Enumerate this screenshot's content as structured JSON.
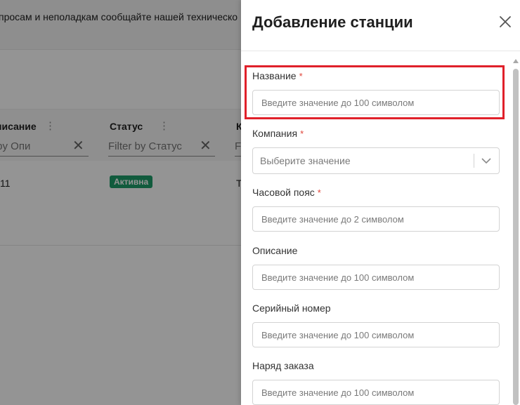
{
  "background": {
    "notice_text": "просам и неполадкам сообщайте нашей техническо",
    "columns": [
      {
        "title": "писание",
        "filter_placeholder": "r by Опи"
      },
      {
        "title": "Статус",
        "filter_placeholder": "Filter by Статус"
      },
      {
        "title": "К",
        "filter_placeholder": "F"
      }
    ],
    "row": {
      "description": "11",
      "status": "Активна",
      "next_col": "Т"
    },
    "colors": {
      "status_badge": "#1e9e6a"
    }
  },
  "drawer": {
    "title": "Добавление станции",
    "close_icon": "close-icon",
    "required_mark": "*",
    "fields": {
      "name": {
        "label": "Название",
        "placeholder": "Введите значение до 100 символом",
        "required": true
      },
      "company": {
        "label": "Компания",
        "placeholder": "Выберите значение",
        "required": true
      },
      "timezone": {
        "label": "Часовой пояс",
        "placeholder": "Введите значение до 2 символом",
        "required": true
      },
      "description": {
        "label": "Описание",
        "placeholder": "Введите значение до 100 символом",
        "required": false
      },
      "serial": {
        "label": "Серийный номер",
        "placeholder": "Введите значение до 100 символом",
        "required": false
      },
      "order": {
        "label": "Наряд заказа",
        "placeholder": "Введите значение до 100 символом",
        "required": false
      }
    },
    "colors": {
      "required": "#e0453a",
      "highlight": "#e0202a"
    }
  }
}
